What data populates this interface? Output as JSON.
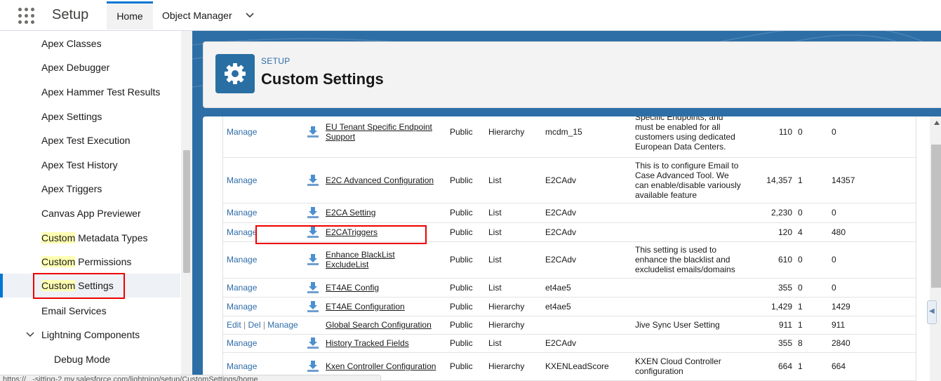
{
  "topbar": {
    "app_title": "Setup",
    "tabs": [
      {
        "label": "Home"
      },
      {
        "label": "Object Manager"
      }
    ]
  },
  "sidebar": {
    "items": [
      {
        "label": "Apex Classes"
      },
      {
        "label": "Apex Debugger"
      },
      {
        "label": "Apex Hammer Test Results"
      },
      {
        "label": "Apex Settings"
      },
      {
        "label": "Apex Test Execution"
      },
      {
        "label": "Apex Test History"
      },
      {
        "label": "Apex Triggers"
      },
      {
        "label": "Canvas App Previewer"
      },
      {
        "highlight": "Custom",
        "rest": " Metadata Types"
      },
      {
        "highlight": "Custom",
        "rest": " Permissions"
      },
      {
        "highlight": "Custom",
        "rest": " Settings",
        "selected": true
      },
      {
        "label": "Email Services"
      },
      {
        "label": "Lightning Components"
      },
      {
        "label": "Debug Mode"
      }
    ]
  },
  "header": {
    "breadcrumb": "SETUP",
    "title": "Custom Settings",
    "icon": "gear-icon"
  },
  "table": {
    "rows": [
      {
        "action": "Manage",
        "label_line1": "EU Tenant Specific Endpoint",
        "label_line2": "Support",
        "visibility": "Public",
        "type": "Hierarchy",
        "namespace": "mcdm_15",
        "description": "Specific Endpoints, and must be enabled for all customers using dedicated European Data Centers.",
        "size": "110",
        "records": "0",
        "total": "0"
      },
      {
        "action": "Manage",
        "label": "E2C Advanced Configuration",
        "visibility": "Public",
        "type": "List",
        "namespace": "E2CAdv",
        "description": "This is to configure Email to Case Advanced Tool. We can enable/disable variously available feature",
        "size": "14,357",
        "records": "1",
        "total": "14357"
      },
      {
        "action": "Manage",
        "label": "E2CA Setting",
        "visibility": "Public",
        "type": "List",
        "namespace": "E2CAdv",
        "description": "",
        "size": "2,230",
        "records": "0",
        "total": "0"
      },
      {
        "action": "Manage",
        "label": "E2CATriggers",
        "visibility": "Public",
        "type": "List",
        "namespace": "E2CAdv",
        "description": "",
        "size": "120",
        "records": "4",
        "total": "480"
      },
      {
        "action": "Manage",
        "label_line1": "Enhance BlackList",
        "label_line2": "ExcludeList",
        "visibility": "Public",
        "type": "List",
        "namespace": "E2CAdv",
        "description": "This setting is used to enhance the blacklist and excludelist emails/domains",
        "size": "610",
        "records": "0",
        "total": "0"
      },
      {
        "action": "Manage",
        "label": "ET4AE Config",
        "visibility": "Public",
        "type": "List",
        "namespace": "et4ae5",
        "description": "",
        "size": "355",
        "records": "0",
        "total": "0"
      },
      {
        "action": "Manage",
        "label": "ET4AE Configuration",
        "visibility": "Public",
        "type": "Hierarchy",
        "namespace": "et4ae5",
        "description": "",
        "size": "1,429",
        "records": "1",
        "total": "1429"
      },
      {
        "edit": "Edit",
        "del": "Del",
        "action": "Manage",
        "label": "Global Search Configuration",
        "visibility": "Public",
        "type": "Hierarchy",
        "namespace": "",
        "description": "Jive Sync User Setting",
        "size": "911",
        "records": "1",
        "total": "911"
      },
      {
        "action": "Manage",
        "label": "History Tracked Fields",
        "visibility": "Public",
        "type": "List",
        "namespace": "E2CAdv",
        "description": "",
        "size": "355",
        "records": "8",
        "total": "2840"
      },
      {
        "action": "Manage",
        "label": "Kxen Controller Configuration",
        "visibility": "Public",
        "type": "Hierarchy",
        "namespace": "KXENLeadScore",
        "description": "KXEN Cloud Controller configuration",
        "size": "664",
        "records": "1",
        "total": "664"
      }
    ]
  },
  "statusbar": {
    "url": "https://...-sitting-2.my.salesforce.com/lightning/setup/CustomSettings/home"
  },
  "colors": {
    "brand_blue": "#2d6ea6",
    "link_blue": "#2e6ca8",
    "highlight_yellow": "#ffffb3",
    "annotation_red": "#ee0000"
  }
}
